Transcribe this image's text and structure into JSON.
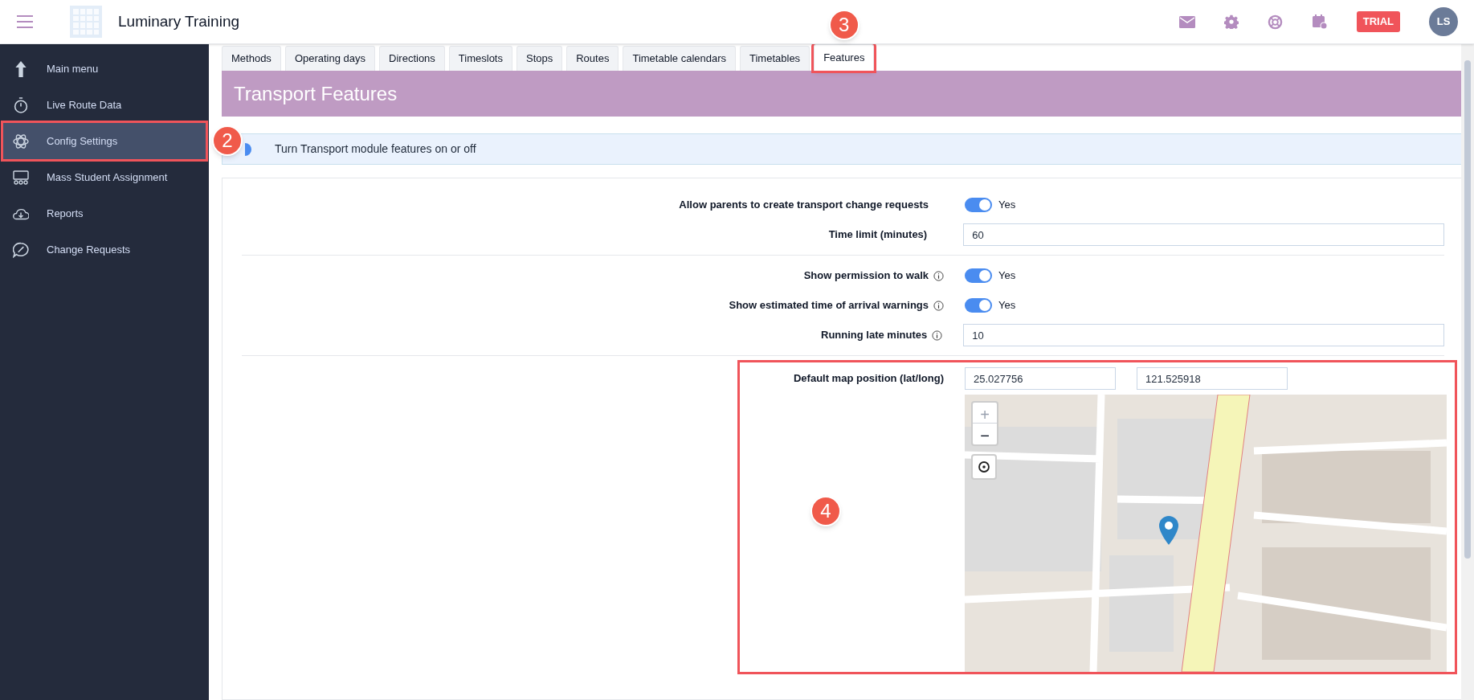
{
  "app": {
    "title": "Luminary Training",
    "trial_badge": "TRIAL",
    "avatar_initials": "LS"
  },
  "sidebar": {
    "items": [
      {
        "label": "Main menu",
        "selected": false
      },
      {
        "label": "Live Route Data",
        "selected": false
      },
      {
        "label": "Config Settings",
        "selected": true,
        "callout": "2"
      },
      {
        "label": "Mass Student Assignment",
        "selected": false
      },
      {
        "label": "Reports",
        "selected": false
      },
      {
        "label": "Change Requests",
        "selected": false
      }
    ]
  },
  "tabs": [
    {
      "label": "Methods",
      "selected": false
    },
    {
      "label": "Operating days",
      "selected": false
    },
    {
      "label": "Directions",
      "selected": false
    },
    {
      "label": "Timeslots",
      "selected": false
    },
    {
      "label": "Stops",
      "selected": false
    },
    {
      "label": "Routes",
      "selected": false
    },
    {
      "label": "Timetable calendars",
      "selected": false
    },
    {
      "label": "Timetables",
      "selected": false
    },
    {
      "label": "Features",
      "selected": true,
      "callout": "3"
    }
  ],
  "page_title": "Transport Features",
  "info_bar": {
    "text": "Turn Transport module features on or off"
  },
  "sections": [
    {
      "rows": [
        {
          "kind": "toggle",
          "label": "Allow parents to create transport change requests",
          "info": false,
          "on": true,
          "value_label": "Yes"
        },
        {
          "kind": "input",
          "label": "Time limit (minutes)",
          "info": false,
          "value": "60"
        }
      ]
    },
    {
      "rows": [
        {
          "kind": "toggle",
          "label": "Show permission to walk",
          "info": true,
          "on": true,
          "value_label": "Yes"
        },
        {
          "kind": "toggle",
          "label": "Show estimated time of arrival warnings",
          "info": true,
          "on": true,
          "value_label": "Yes"
        },
        {
          "kind": "input",
          "label": "Running late minutes",
          "info": true,
          "value": "10"
        }
      ]
    }
  ],
  "map_section": {
    "label": "Default map position (lat/long)",
    "latitude": "25.027756",
    "longitude": "121.525918",
    "callout": "4",
    "zoom_in": "+",
    "zoom_out": "−"
  }
}
